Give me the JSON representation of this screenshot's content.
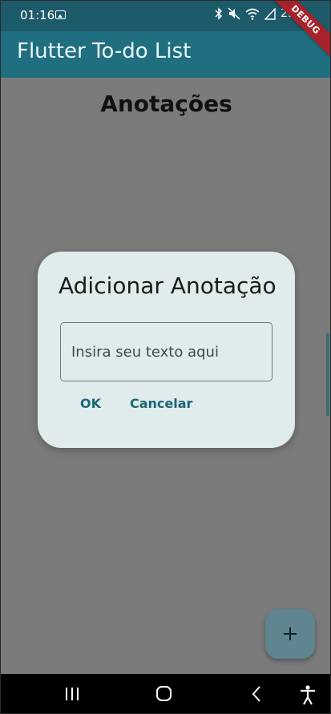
{
  "status_bar": {
    "time": "01:16",
    "battery": "25",
    "icons": [
      "gallery-icon",
      "bluetooth-icon",
      "mute-icon",
      "wifi-icon",
      "signal-icon"
    ]
  },
  "debug_banner": "DEBUG",
  "app_bar": {
    "title": "Flutter To-do List"
  },
  "page": {
    "heading": "Anotações"
  },
  "dialog": {
    "title": "Adicionar Anotação",
    "input": {
      "value": "",
      "placeholder": "Insira seu texto aqui"
    },
    "ok_label": "OK",
    "cancel_label": "Cancelar"
  },
  "fab": {
    "icon": "plus-icon"
  },
  "nav_bar": {
    "icons": [
      "recents-icon",
      "home-icon",
      "back-icon",
      "accessibility-icon"
    ]
  },
  "colors": {
    "app_bar": "#1f6f80",
    "status_bar": "#1d5a6a",
    "dialog_bg": "#e0ebeb",
    "accent": "#1a6776",
    "scrim": "#7b7b7b",
    "debug_ribbon": "#a8222a"
  }
}
